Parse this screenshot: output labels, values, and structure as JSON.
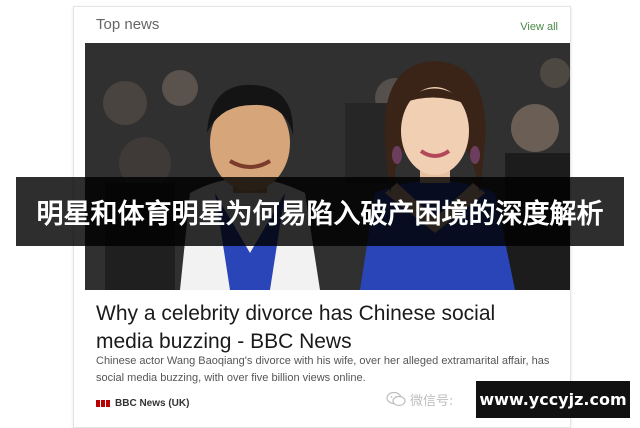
{
  "card": {
    "title": "Top news",
    "view_all": "View all",
    "headline": "Why a celebrity divorce has Chinese social media buzzing - BBC News",
    "snippet": "Chinese actor Wang Baoqiang's divorce with his wife, over her alleged extramarital affair, has social media buzzing, with over five billion views online.",
    "source": "BBC News (UK)"
  },
  "overlay": {
    "title": "明星和体育明星为何易陷入破产困境的深度解析"
  },
  "watermark": {
    "label": "微信号:",
    "icon": "wechat-icon"
  },
  "site_badge": {
    "url": "www.yccyjz.com"
  },
  "colors": {
    "view_all": "#4a8a4a",
    "bbc_red": "#b80000",
    "overlay_bg": "#000000",
    "dress_blue": "#2a45b8"
  }
}
